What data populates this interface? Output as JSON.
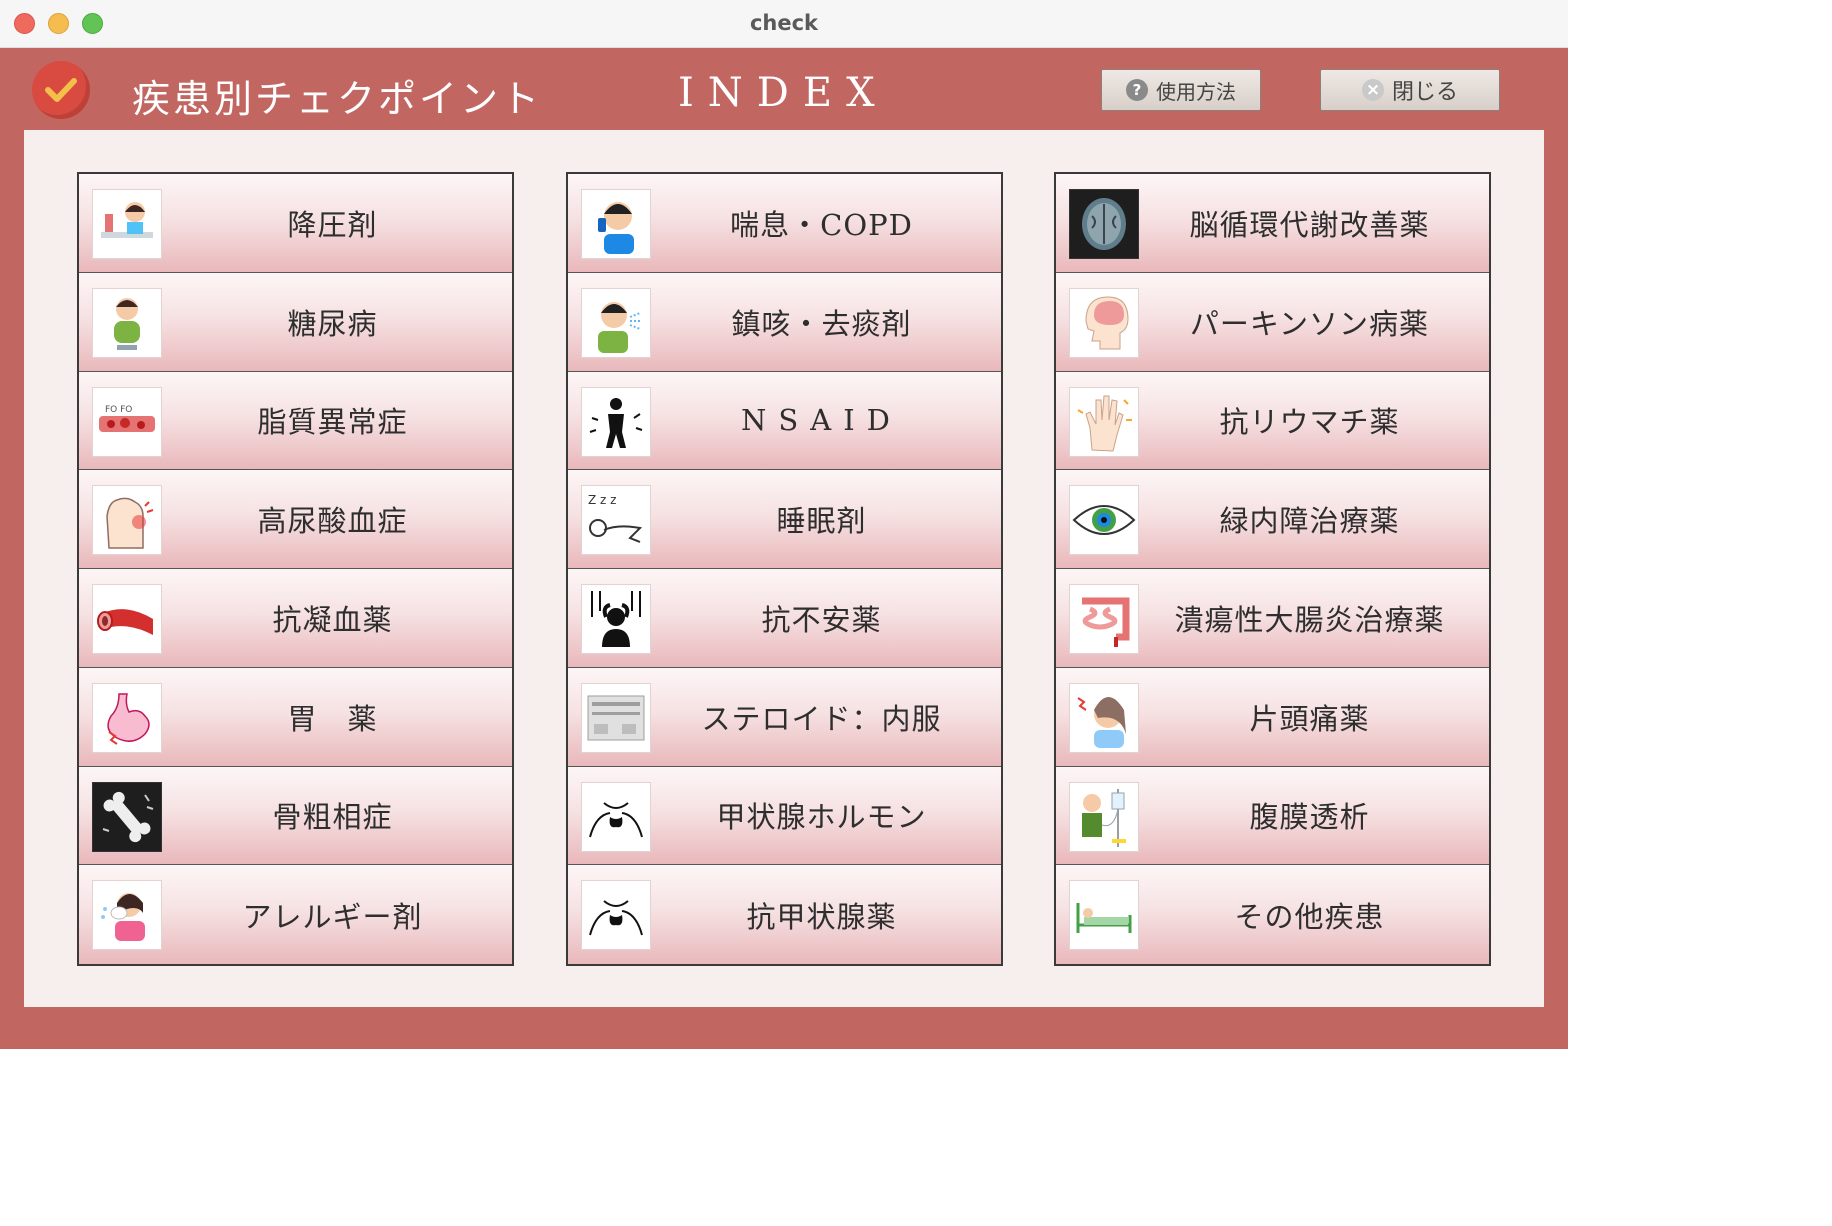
{
  "window": {
    "title": "check"
  },
  "header": {
    "app_title": "疾患別チェクポイント",
    "index_label": "INDEX",
    "help_button": "使用方法",
    "close_button": "閉じる"
  },
  "colors": {
    "frame": "#c26662",
    "panel": "#f7efed",
    "badge": "#d94a40"
  },
  "columns": [
    {
      "items": [
        {
          "label": "降圧剤",
          "icon": "blood-pressure-icon"
        },
        {
          "label": "糖尿病",
          "icon": "diabetes-person-icon"
        },
        {
          "label": "脂質異常症",
          "icon": "blood-vessel-lipid-icon"
        },
        {
          "label": "高尿酸血症",
          "icon": "gout-foot-icon"
        },
        {
          "label": "抗凝血薬",
          "icon": "artery-icon"
        },
        {
          "label": "胃　薬",
          "icon": "stomach-icon"
        },
        {
          "label": "骨粗相症",
          "icon": "bone-icon"
        },
        {
          "label": "アレルギー剤",
          "icon": "sneezing-person-icon"
        }
      ]
    },
    {
      "items": [
        {
          "label": "喘息・COPD",
          "icon": "inhaler-person-icon"
        },
        {
          "label": "鎮咳・去痰剤",
          "icon": "coughing-person-icon"
        },
        {
          "label": "NSAID",
          "icon": "pain-figure-icon"
        },
        {
          "label": "睡眠剤",
          "icon": "sleeping-person-icon"
        },
        {
          "label": "抗不安薬",
          "icon": "anxiety-figure-icon"
        },
        {
          "label": "ステロイド：内服",
          "icon": "pill-sheet-icon"
        },
        {
          "label": "甲状腺ホルモン",
          "icon": "thyroid-icon"
        },
        {
          "label": "抗甲状腺薬",
          "icon": "thyroid-icon"
        }
      ]
    },
    {
      "items": [
        {
          "label": "脳循環代謝改善薬",
          "icon": "brain-scan-icon"
        },
        {
          "label": "パーキンソン病薬",
          "icon": "brain-head-icon"
        },
        {
          "label": "抗リウマチ薬",
          "icon": "rheumatic-hand-icon"
        },
        {
          "label": "緑内障治療薬",
          "icon": "eye-icon"
        },
        {
          "label": "潰瘍性大腸炎治療薬",
          "icon": "intestine-icon"
        },
        {
          "label": "片頭痛薬",
          "icon": "headache-person-icon"
        },
        {
          "label": "腹膜透析",
          "icon": "dialysis-icon"
        },
        {
          "label": "その他疾患",
          "icon": "hospital-bed-icon"
        }
      ]
    }
  ]
}
